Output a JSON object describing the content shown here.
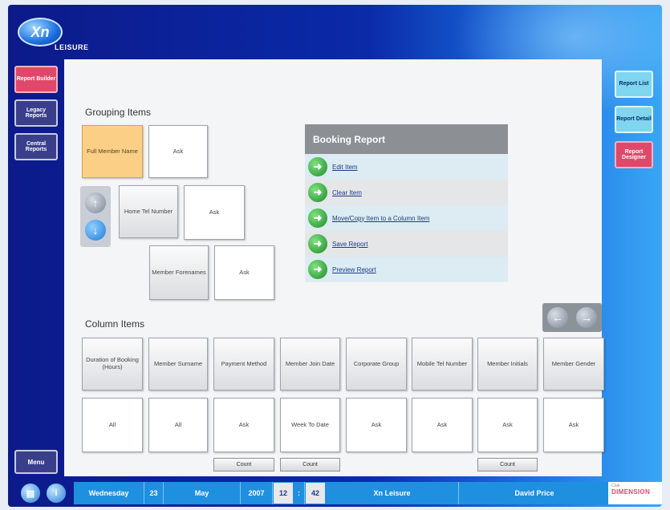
{
  "app": {
    "logo_mark": "Xn",
    "logo_text": "LEISURE"
  },
  "left_nav": [
    {
      "label": "Report Builder",
      "icon": "report-builder",
      "active": true
    },
    {
      "label": "Legacy Reports",
      "icon": "legacy-reports",
      "active": false
    },
    {
      "label": "Central Reports",
      "icon": "central-reports",
      "active": false
    }
  ],
  "menu_label": "Menu",
  "right_nav": [
    {
      "label": "Report List"
    },
    {
      "label": "Report Detail"
    },
    {
      "label": "Report Designer",
      "active": true
    }
  ],
  "grouping": {
    "title": "Grouping Items",
    "rows": [
      {
        "item": "Full Member Name",
        "value": "Ask"
      },
      {
        "item": "Home Tel Number",
        "value": "Ask"
      },
      {
        "item": "Member Forenames",
        "value": "Ask"
      }
    ]
  },
  "booking_report": {
    "title": "Booking Report",
    "actions": [
      "Edit Item",
      "Clear Item",
      "Move/Copy Item to a Column Item",
      "Save Report",
      "Preview Report"
    ]
  },
  "columns": {
    "title": "Column Items",
    "items": [
      {
        "header": "Duration of Booking (Hours)",
        "value": "All",
        "count": ""
      },
      {
        "header": "Member Surname",
        "value": "All",
        "count": ""
      },
      {
        "header": "Payment Method",
        "value": "Ask",
        "count": "Count"
      },
      {
        "header": "Member Join Date",
        "value": "Week To Date",
        "count": "Count"
      },
      {
        "header": "Corporate Group",
        "value": "Ask",
        "count": ""
      },
      {
        "header": "Mobile Tel Number",
        "value": "Ask",
        "count": ""
      },
      {
        "header": "Member Initials",
        "value": "Ask",
        "count": "Count"
      },
      {
        "header": "Member Gender",
        "value": "Ask",
        "count": ""
      }
    ]
  },
  "status_bar": {
    "day": "Wednesday",
    "date": "23",
    "month": "May",
    "year": "2007",
    "hour": "12",
    "separator": ":",
    "minute": "42",
    "site": "Xn Leisure",
    "user": "David Price"
  },
  "brand": {
    "small": "Club",
    "big": "DIMENSION"
  },
  "colors": {
    "accent_red": "#e0486a",
    "nav_blue": "#3a3f8c",
    "cyan": "#7fd6ee",
    "status_blue": "#1f8fe0",
    "grouping_highlight": "#fbcf86"
  }
}
